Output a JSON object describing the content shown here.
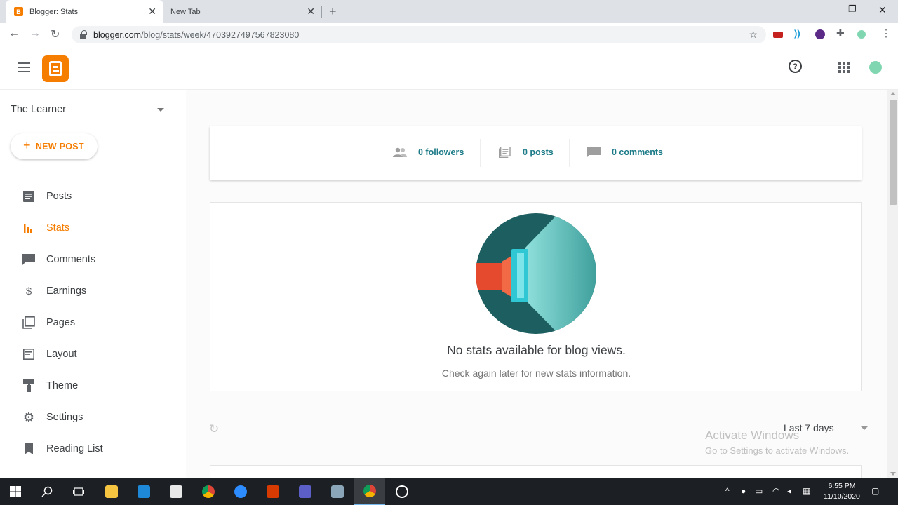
{
  "browser": {
    "tabs": [
      {
        "title": "Blogger: Stats",
        "active": true
      },
      {
        "title": "New Tab",
        "active": false
      }
    ],
    "url_domain": "blogger.com",
    "url_path": "/blog/stats/week/4703927497567823080",
    "window_controls": [
      "minimize",
      "maximize",
      "close"
    ]
  },
  "header": {
    "logo": "blogger-logo",
    "icons": [
      "menu-icon",
      "help-icon",
      "apps-icon",
      "avatar"
    ]
  },
  "sidebar": {
    "blog_name": "The Learner",
    "new_post_label": "NEW POST",
    "items": [
      {
        "label": "Posts",
        "icon": "posts-icon",
        "active": false
      },
      {
        "label": "Stats",
        "icon": "stats-icon",
        "active": true
      },
      {
        "label": "Comments",
        "icon": "comments-icon",
        "active": false
      },
      {
        "label": "Earnings",
        "icon": "dollar-icon",
        "active": false
      },
      {
        "label": "Pages",
        "icon": "pages-icon",
        "active": false
      },
      {
        "label": "Layout",
        "icon": "layout-icon",
        "active": false
      },
      {
        "label": "Theme",
        "icon": "theme-icon",
        "active": false
      },
      {
        "label": "Settings",
        "icon": "gear-icon",
        "active": false
      },
      {
        "label": "Reading List",
        "icon": "bookmark-icon",
        "active": false
      }
    ]
  },
  "stats": {
    "followers": "0 followers",
    "posts": "0 posts",
    "comments": "0 comments"
  },
  "empty": {
    "title": "No stats available for blog views.",
    "subtitle": "Check again later for new stats information."
  },
  "range": {
    "selected": "Last 7 days"
  },
  "watermark": {
    "line1": "Activate Windows",
    "line2": "Go to Settings to activate Windows."
  },
  "taskbar": {
    "time": "6:55 PM",
    "date": "11/10/2020"
  },
  "colors": {
    "accent": "#f57d00",
    "link": "#1c7b87",
    "illustration_dark": "#1d5e60",
    "illustration_light": "#7fd7d2"
  }
}
